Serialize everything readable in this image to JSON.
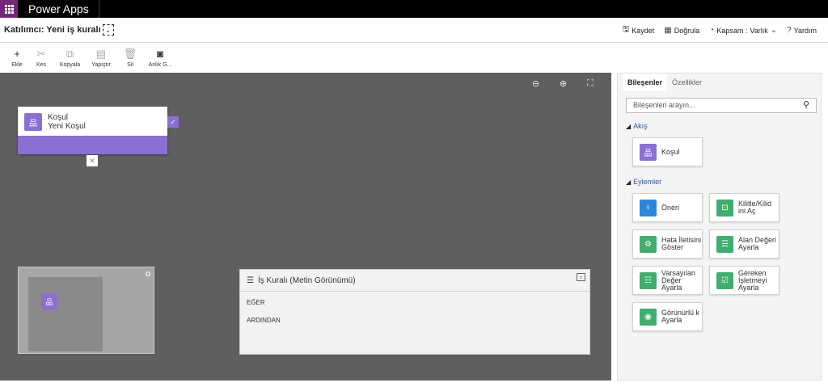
{
  "topbar": {
    "app_name": "Power Apps"
  },
  "title": {
    "text": "Katılımcı: Yeni iş kuralı",
    "chevron": "⌄"
  },
  "title_actions": {
    "save": "Kaydet",
    "validate": "Doğrula",
    "scope_label": "Kapsam :",
    "scope_value": "Varlık",
    "help": "Yardım"
  },
  "toolbar": {
    "add": "Ekle",
    "cut": "Kes",
    "copy": "Kopyala",
    "paste": "Yapıştır",
    "delete": "Sil",
    "snapshot": "Anlık G..."
  },
  "canvas": {
    "condition_type": "Koşul",
    "condition_name": "Yeni Koşul"
  },
  "text_view": {
    "title": "İş Kuralı (Metin Görünümü)",
    "if": "EĞER",
    "then": "ARDINDAN"
  },
  "panel": {
    "tabs": [
      "Bileşenler",
      "Özellikler"
    ],
    "search_placeholder": "Bileşenleri arayın...",
    "section_flow": "Akış",
    "section_actions": "Eylemler",
    "flow_tiles": [
      {
        "label": "Koşul",
        "color": "#8b6fd3",
        "icon": "condition-icon"
      }
    ],
    "action_tiles": [
      {
        "label": "Öneri",
        "color": "#2b88d8",
        "icon": "lightbulb-icon"
      },
      {
        "label": "Kilitle/Kilid ini Aç",
        "color": "#3fae6f",
        "icon": "lock-icon"
      },
      {
        "label": "Hata İletisini Göster",
        "color": "#3fae6f",
        "icon": "error-icon"
      },
      {
        "label": "Alan Değeri Ayarla",
        "color": "#3fae6f",
        "icon": "field-value-icon"
      },
      {
        "label": "Varsayılan Değer Ayarla",
        "color": "#3fae6f",
        "icon": "default-value-icon"
      },
      {
        "label": "Gereken İşletmeyi Ayarla",
        "color": "#3fae6f",
        "icon": "required-icon"
      },
      {
        "label": "Görünürlü k Ayarla",
        "color": "#3fae6f",
        "icon": "visibility-icon"
      }
    ]
  }
}
